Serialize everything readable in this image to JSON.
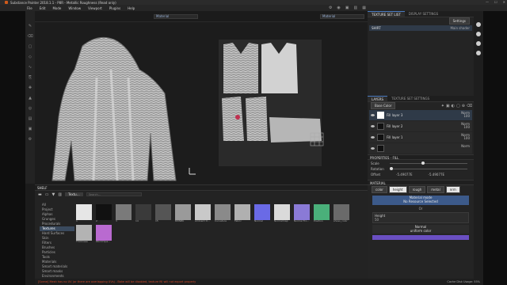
{
  "window": {
    "title": "Substance Painter 2018.1.1 - P8R - Metallic Roughness (Read only)",
    "controls": [
      "—",
      "☐",
      "✕"
    ]
  },
  "menu": [
    "File",
    "Edit",
    "Mode",
    "Window",
    "Viewport",
    "Plugins",
    "Help"
  ],
  "viewport": {
    "left_select": "Material",
    "right_select": "Material"
  },
  "texture_set": {
    "tabs": [
      "TEXTURE SET LIST",
      "DISPLAY SETTINGS"
    ],
    "settings_label": "Settings",
    "item": {
      "name": "SHIRT",
      "shader": "Main shader"
    }
  },
  "layers": {
    "tabs": [
      "LAYERS",
      "TEXTURE SET SETTINGS"
    ],
    "channel": "Base Color",
    "rows": [
      {
        "name": "Fill layer 3",
        "blend": "Norm",
        "opacity": "100",
        "thumb": "white"
      },
      {
        "name": "Fill layer 2",
        "blend": "Norm",
        "opacity": "100",
        "thumb": "dark"
      },
      {
        "name": "Fill layer 1",
        "blend": "Norm",
        "opacity": "100",
        "thumb": "dark"
      },
      {
        "name": "",
        "blend": "Norm",
        "opacity": "",
        "thumb": "dark"
      }
    ]
  },
  "properties": {
    "header": "PROPERTIES - FILL",
    "sliders": [
      {
        "label": "Scale",
        "value": "",
        "pos": 0.5
      },
      {
        "label": "Rotation",
        "value": "",
        "pos": 0.0
      },
      {
        "label": "Offset",
        "value1": "-5.49077E",
        "value2": "-5.49077E"
      }
    ],
    "material_label": "MATERIAL",
    "material_buttons": [
      "color",
      "height",
      "rough",
      "metal",
      "nrm"
    ],
    "material_buttons_on": [
      false,
      true,
      false,
      false,
      true
    ],
    "material_mode": {
      "title": "Material mode",
      "value": "No Resource Selected"
    },
    "or_label": "Or",
    "height": {
      "label": "Height",
      "value": "50"
    },
    "normal": {
      "label": "Normal",
      "value": "uniform color"
    }
  },
  "shelf": {
    "title": "SHELF",
    "filter_label": "Textu…",
    "search_placeholder": "Search...",
    "categories": [
      "All",
      "Project",
      "Alphas",
      "Grunges",
      "Procedurals",
      "Textures",
      "Hard Surfaces",
      "Skin",
      "Filters",
      "Brushes",
      "Particles",
      "Tools",
      "Materials",
      "Smart materials",
      "Smart masks",
      "Environments",
      "Color profiles"
    ],
    "active_category": "Textures",
    "items": [
      {
        "label": "1",
        "tone": "#e6e6e6"
      },
      {
        "label": "2",
        "tone": "#111111"
      },
      {
        "label": "3",
        "tone": "#7a7a7a"
      },
      {
        "label": "14",
        "tone": "#3a3a3a"
      },
      {
        "label": "15",
        "tone": "#555555"
      },
      {
        "label": "BWNBK",
        "tone": "#9a9a9a"
      },
      {
        "label": "Ambient O…",
        "tone": "#c9c9c9"
      },
      {
        "label": "Curvature",
        "tone": "#8a8a8a"
      },
      {
        "label": "Fabric",
        "tone": "#b0b0b0"
      },
      {
        "label": "Normal",
        "tone": "#6a6ae6"
      },
      {
        "label": "Normalmap",
        "tone": "#dadada"
      },
      {
        "label": "Normal Fro…",
        "tone": "#8a7ad6"
      },
      {
        "label": "Position",
        "tone": "#4ab07a"
      },
      {
        "label": "shoes_color",
        "tone": "#6a6a6a"
      },
      {
        "label": "Thickness",
        "tone": "#b3b3b3"
      },
      {
        "label": "World Spa…",
        "tone": "#b96ad0"
      }
    ]
  },
  "status": {
    "message": "[Scene] Mesh has no UV (or there are overlapping UVs) - Bake will be disabled, texture fill will not export properly",
    "cache": "Cache Disk Usage:  55%"
  }
}
